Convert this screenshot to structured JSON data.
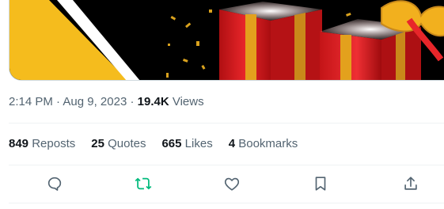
{
  "post_meta": {
    "time": "2:14 PM",
    "separator": " · ",
    "date": "Aug 9, 2023",
    "views_count": "19.4K",
    "views_label": "Views"
  },
  "stats": [
    {
      "count": "849",
      "label": "Reposts"
    },
    {
      "count": "25",
      "label": "Quotes"
    },
    {
      "count": "665",
      "label": "Likes"
    },
    {
      "count": "4",
      "label": "Bookmarks"
    }
  ],
  "actions": [
    {
      "icon": "reply-icon",
      "active": false
    },
    {
      "icon": "repost-icon",
      "active": true,
      "color": "#00ba7c"
    },
    {
      "icon": "like-icon",
      "active": false
    },
    {
      "icon": "bookmark-icon",
      "active": false
    },
    {
      "icon": "share-icon",
      "active": false
    }
  ],
  "colors": {
    "text_primary": "#0f1419",
    "text_secondary": "#536471",
    "divider": "#eff3f4",
    "repost_active": "#00ba7c",
    "gift_red": "#d91a1a",
    "ribbon_gold": "#f2b01e"
  }
}
